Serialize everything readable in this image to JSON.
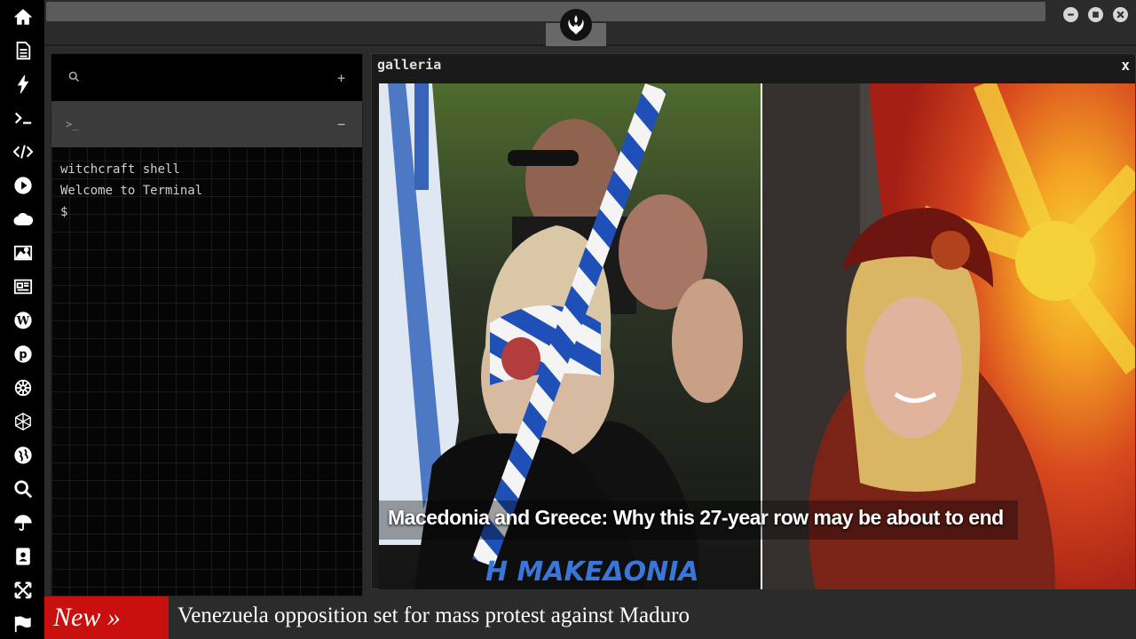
{
  "sidebar": {
    "icons": [
      "home-icon",
      "document-icon",
      "bolt-icon",
      "terminal-icon",
      "code-icon",
      "play-icon",
      "cloud-icon",
      "image-icon",
      "newspaper-icon",
      "wordpress-icon",
      "pinterest-icon",
      "settings-wheel-icon",
      "network-icon",
      "globe-icon",
      "search-icon",
      "umbrella-icon",
      "contacts-icon",
      "expand-icon",
      "flag-icon"
    ]
  },
  "topbar": {
    "logo": "rebel-alliance-logo"
  },
  "terminal": {
    "search_icon": "search-icon",
    "add_label": "+",
    "tab_prompt": ">_",
    "collapse_label": "−",
    "lines": [
      "witchcraft shell",
      "Welcome to Terminal",
      "$"
    ]
  },
  "gallery": {
    "title": "galleria",
    "close_label": "x",
    "caption": "Macedonia and Greece: Why this 27-year row may be about to end",
    "banner_text": "Η ΜΑΚΕΔΟΝΙΑ"
  },
  "ticker": {
    "badge": "New »",
    "headline": "Venezuela opposition set for mass protest against Maduro"
  },
  "colors": {
    "ticker_badge": "#c8100e",
    "sidebar_bg": "#000000",
    "panel_bg": "#2b2b2b"
  }
}
